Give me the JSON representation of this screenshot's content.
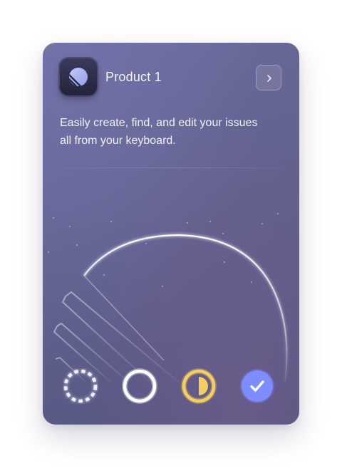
{
  "product": {
    "name": "Product 1",
    "description": "Easily create, find, and edit your issues all from your keyboard.",
    "logo_icon": "product-logo-icon"
  },
  "actions": {
    "next_icon": "chevron-right-icon"
  },
  "statuses": [
    {
      "icon": "status-backlog-icon",
      "color": "#f2f2ff"
    },
    {
      "icon": "status-todo-icon",
      "color": "#ffffff"
    },
    {
      "icon": "status-in-progress-icon",
      "color": "#f4cf5c"
    },
    {
      "icon": "status-done-icon",
      "color": "#7d8cff"
    }
  ],
  "colors": {
    "card_background": "#62628f",
    "text": "#f3f3fb",
    "accent_blue": "#7d8cff",
    "accent_yellow": "#f4cf5c"
  }
}
